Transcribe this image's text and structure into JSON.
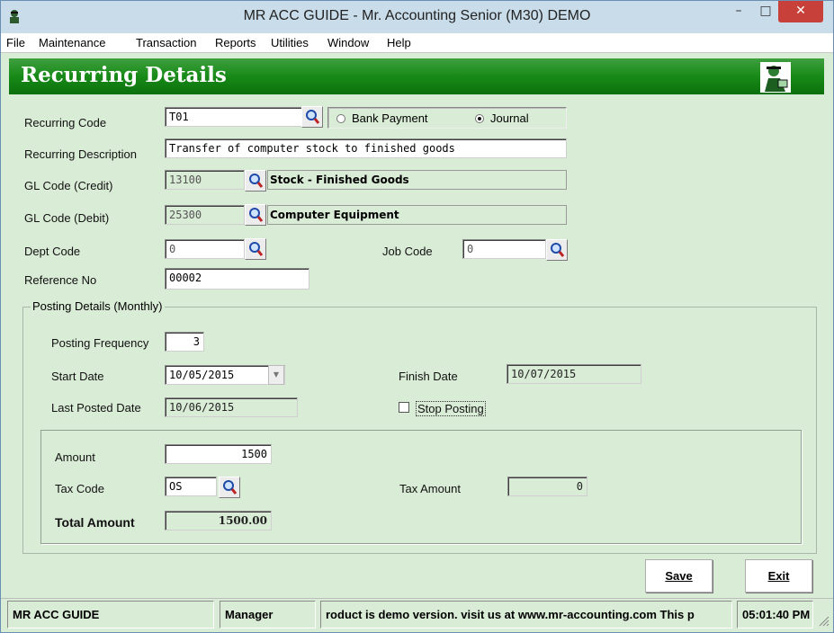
{
  "window": {
    "title": "MR ACC GUIDE - Mr. Accounting Senior (M30) DEMO",
    "min_glyph": "–",
    "max_glyph": "□",
    "close_glyph": "✕"
  },
  "menu": [
    "File",
    "Maintenance",
    "Transaction",
    "Reports",
    "Utilities",
    "Window",
    "Help"
  ],
  "header": {
    "title": "Recurring Details"
  },
  "form": {
    "recurring_code_label": "Recurring Code",
    "recurring_code": "T01",
    "type_options": [
      {
        "label": "Bank Payment",
        "selected": false
      },
      {
        "label": "Journal",
        "selected": true
      }
    ],
    "description_label": "Recurring Description",
    "description": "Transfer of computer stock to finished goods",
    "gl_credit_label": "GL Code (Credit)",
    "gl_credit_code": "13100",
    "gl_credit_name": "Stock - Finished Goods",
    "gl_debit_label": "GL Code (Debit)",
    "gl_debit_code": "25300",
    "gl_debit_name": "Computer Equipment",
    "dept_code_label": "Dept Code",
    "dept_code": "0",
    "job_code_label": "Job Code",
    "job_code": "0",
    "reference_label": "Reference No",
    "reference_no": "00002"
  },
  "posting": {
    "group_label": "Posting Details (Monthly)",
    "frequency_label": "Posting Frequency",
    "frequency": "3",
    "start_date_label": "Start Date",
    "start_date": "10/05/2015",
    "finish_date_label": "Finish Date",
    "finish_date": "10/07/2015",
    "last_posted_label": "Last Posted Date",
    "last_posted": "10/06/2015",
    "stop_posting_label": "Stop Posting",
    "stop_posting_checked": false
  },
  "amounts": {
    "amount_label": "Amount",
    "amount": "1500",
    "tax_code_label": "Tax Code",
    "tax_code": "OS",
    "tax_amount_label": "Tax Amount",
    "tax_amount": "0",
    "total_label": "Total Amount",
    "total": "1500.00"
  },
  "buttons": {
    "save": "Save",
    "exit": "Exit"
  },
  "status": {
    "company": "MR ACC GUIDE",
    "user": "Manager",
    "message": "roduct is demo version.  visit us at www.mr-accounting.com This p",
    "time": "05:01:40 PM"
  },
  "colors": {
    "form_bg": "#d9ecd6",
    "header_green": "#178a17",
    "close_red": "#c7413a"
  }
}
